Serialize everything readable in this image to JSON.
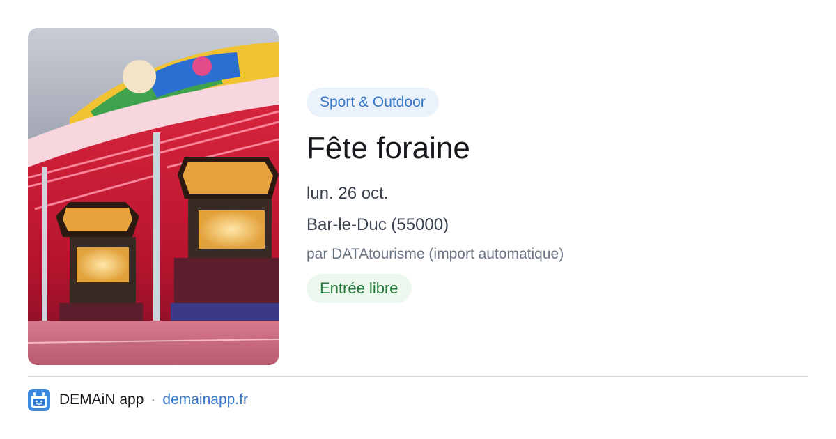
{
  "event": {
    "category": "Sport & Outdoor",
    "title": "Fête foraine",
    "date": "lun. 26 oct.",
    "place": "Bar-le-Duc (55000)",
    "author": "par DATAtourisme (import automatique)",
    "price": "Entrée libre"
  },
  "footer": {
    "app_name": "DEMAiN app",
    "separator": "·",
    "site": "demainapp.fr"
  },
  "colors": {
    "category_bg": "#eaf2fc",
    "category_text": "#3577c8",
    "price_bg": "#ecf8ee",
    "price_text": "#23793b",
    "link": "#3577c8",
    "logo_bg": "#3d8be0"
  },
  "icons": {
    "app_logo": "demain-logo-icon"
  }
}
